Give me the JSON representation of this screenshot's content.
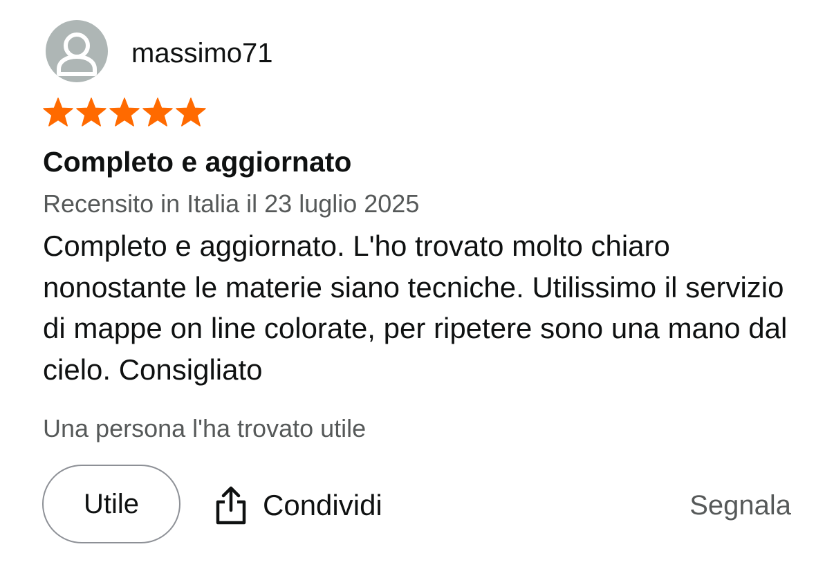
{
  "review": {
    "author": "massimo71",
    "rating": 5,
    "rating_max": 5,
    "title": "Completo e aggiornato",
    "meta": "Recensito in Italia il 23 luglio 2025",
    "body": "Completo e aggiornato. L'ho trovato molto chiaro nonostante le materie siano tecniche. Utilissimo il servizio di mappe on line colorate, per ripetere sono una mano dal cielo. Consigliato",
    "helpful_count_text": "Una persona l'ha trovato utile"
  },
  "actions": {
    "helpful_label": "Utile",
    "share_label": "Condividi",
    "report_label": "Segnala"
  },
  "icons": {
    "avatar": "user-silhouette-icon",
    "star": "star-filled-icon",
    "share": "share-upload-icon"
  },
  "colors": {
    "star": "#ff6a00",
    "avatar_bg": "#aeb6b5",
    "text_primary": "#0f1111",
    "text_secondary": "#565959",
    "button_border": "#8d9096"
  }
}
